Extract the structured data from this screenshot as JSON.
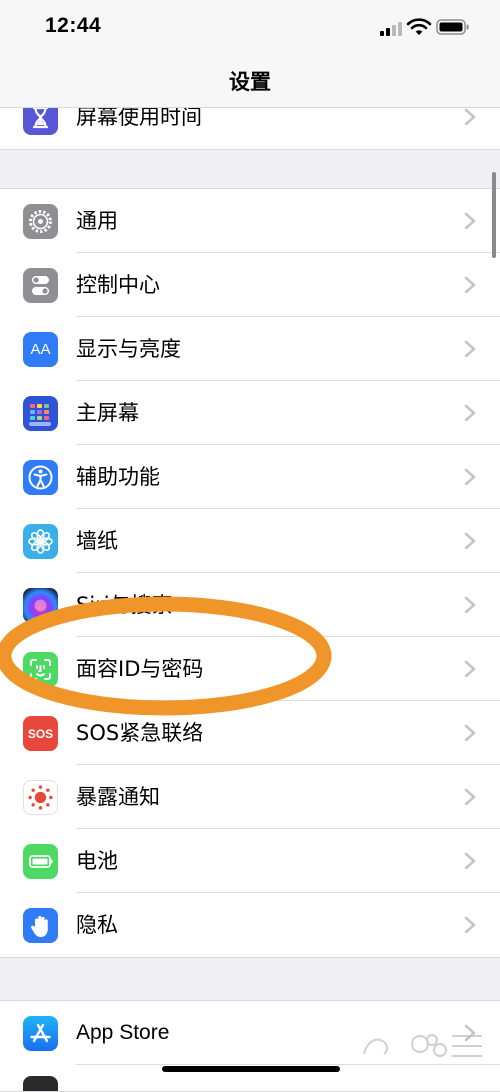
{
  "status_bar": {
    "time": "12:44"
  },
  "nav": {
    "title": "设置"
  },
  "groups": {
    "top": {
      "items": [
        {
          "label": "屏幕使用时间",
          "icon": "hourglass-icon",
          "color": "#5856d6"
        }
      ]
    },
    "main": {
      "items": [
        {
          "label": "通用",
          "icon": "gear-icon",
          "color": "#8e8e93"
        },
        {
          "label": "控制中心",
          "icon": "toggles-icon",
          "color": "#8e8e93"
        },
        {
          "label": "显示与亮度",
          "icon": "aa-icon",
          "icon_text": "AA",
          "color": "#2f7cf6"
        },
        {
          "label": "主屏幕",
          "icon": "home-grid-icon",
          "color": "#2f52d6"
        },
        {
          "label": "辅助功能",
          "icon": "accessibility-icon",
          "color": "#2f7cf6"
        },
        {
          "label": "墙纸",
          "icon": "flower-icon",
          "color": "#3aaee6"
        },
        {
          "label": "Siri与搜索",
          "icon": "siri-icon",
          "color": "#1c1c3c"
        },
        {
          "label": "面容ID与密码",
          "icon": "face-id-icon",
          "color": "#4cd964"
        },
        {
          "label": "SOS紧急联络",
          "icon": "sos-icon",
          "icon_text": "SOS",
          "color": "#e8483b"
        },
        {
          "label": "暴露通知",
          "icon": "exposure-icon",
          "color": "#ffffff"
        },
        {
          "label": "电池",
          "icon": "battery-icon",
          "color": "#4cd964"
        },
        {
          "label": "隐私",
          "icon": "hand-icon",
          "color": "#2f7cf6"
        }
      ]
    },
    "store": {
      "items": [
        {
          "label": "App Store",
          "icon": "app-store-icon",
          "color": "#1a8cf0"
        }
      ]
    }
  },
  "annotation": {
    "color": "#f0952a"
  }
}
